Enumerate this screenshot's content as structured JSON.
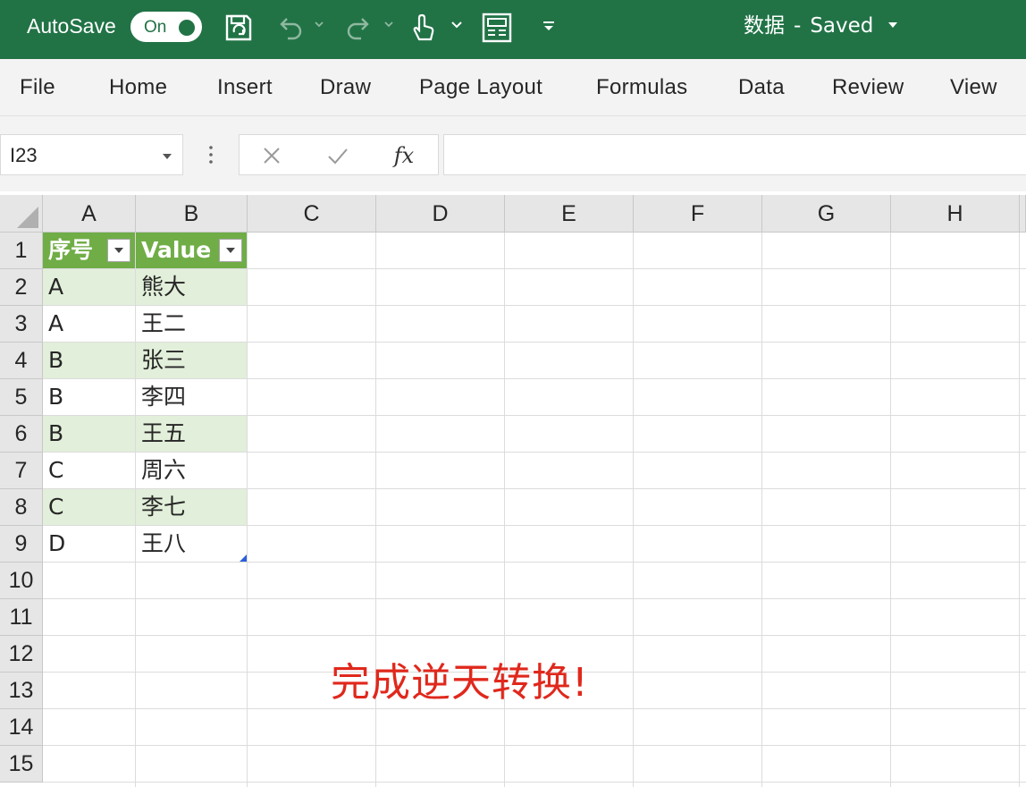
{
  "titlebar": {
    "autosave_label": "AutoSave",
    "autosave_toggle": "On",
    "doc_name": "数据",
    "doc_separator": "-",
    "doc_status": "Saved",
    "background_color": "#217346"
  },
  "ribbon": {
    "tabs": [
      "File",
      "Home",
      "Insert",
      "Draw",
      "Page Layout",
      "Formulas",
      "Data",
      "Review",
      "View"
    ]
  },
  "formula_bar": {
    "name_box": "I23",
    "fx_label": "fx",
    "formula": ""
  },
  "sheet": {
    "column_headers": [
      "A",
      "B",
      "C",
      "D",
      "E",
      "F",
      "G",
      "H"
    ],
    "row_headers": [
      "1",
      "2",
      "3",
      "4",
      "5",
      "6",
      "7",
      "8",
      "9",
      "10",
      "11",
      "12",
      "13",
      "14",
      "15"
    ],
    "table": {
      "headers": [
        "序号",
        "Value"
      ],
      "rows": [
        [
          "A",
          "熊大"
        ],
        [
          "A",
          "王二"
        ],
        [
          "B",
          "张三"
        ],
        [
          "B",
          "李四"
        ],
        [
          "B",
          "王五"
        ],
        [
          "C",
          "周六"
        ],
        [
          "C",
          "李七"
        ],
        [
          "D",
          "王八"
        ]
      ],
      "header_color": "#70ad47",
      "band_color": "#e2efda"
    }
  },
  "annotation": {
    "text": "完成逆天转换!",
    "color": "#e0281c"
  }
}
